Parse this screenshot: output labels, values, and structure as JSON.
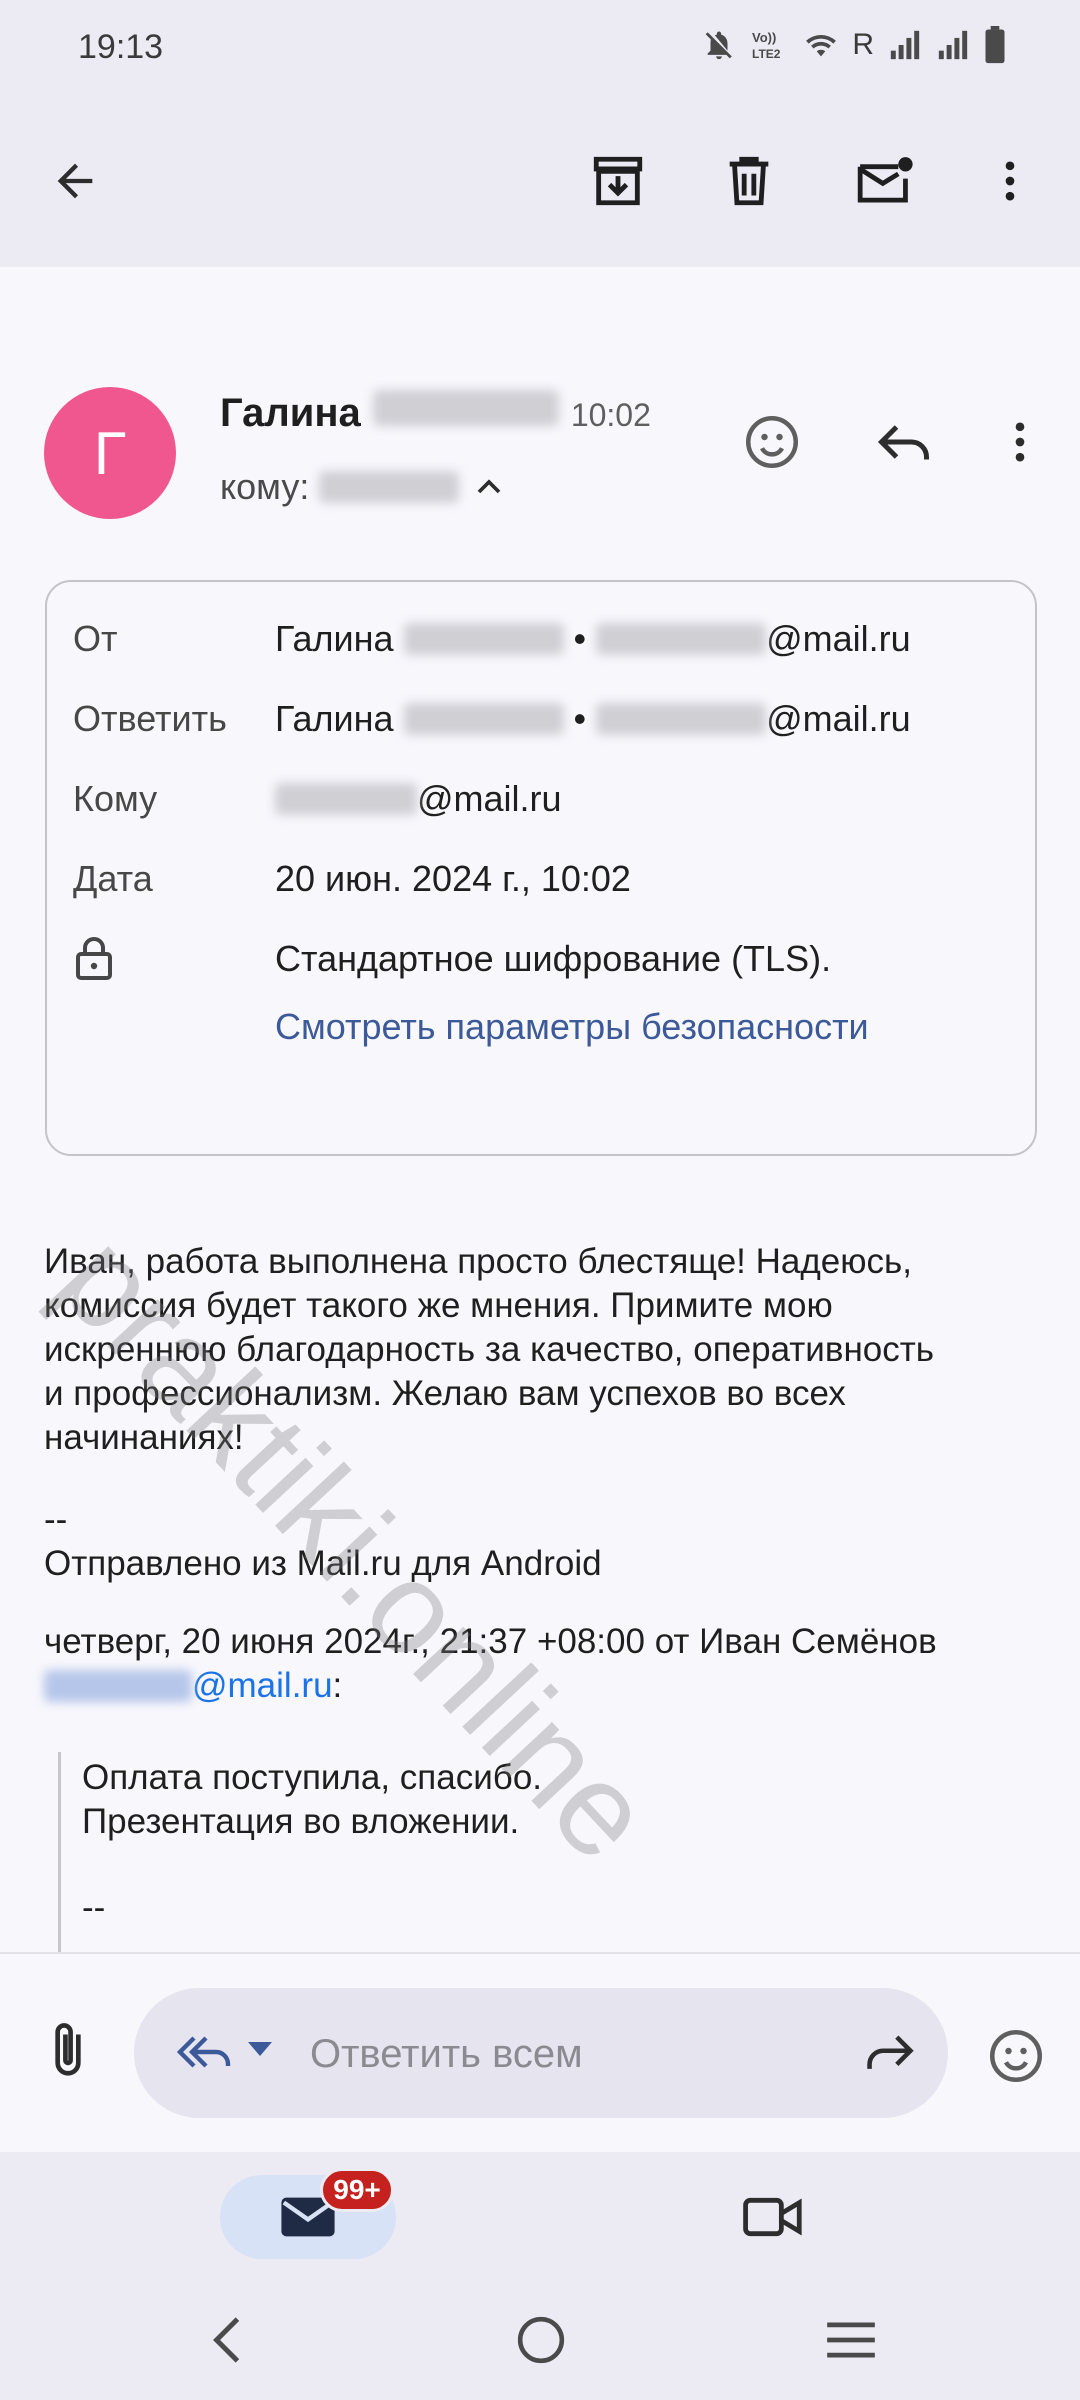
{
  "status_bar": {
    "time": "19:13",
    "roaming_indicator": "R",
    "icons": [
      "bell-off-icon",
      "volte-icon",
      "wifi-icon",
      "signal-icon",
      "signal-icon",
      "battery-icon"
    ]
  },
  "toolbar": {
    "icons": [
      "back-arrow-icon",
      "archive-icon",
      "delete-icon",
      "mark-unread-icon",
      "more-vert-icon"
    ]
  },
  "message_header": {
    "avatar_letter": "Г",
    "avatar_color": "#f0578e",
    "sender_first_name": "Галина",
    "time": "10:02",
    "to_label": "кому:"
  },
  "details": {
    "from_label": "От",
    "from_name": "Галина",
    "from_separator": "•",
    "from_email_domain": "@mail.ru",
    "reply_label": "Ответить",
    "reply_name": "Галина",
    "reply_separator": "•",
    "reply_email_domain": "@mail.ru",
    "to_label": "Кому",
    "to_email_domain": "@mail.ru",
    "date_label": "Дата",
    "date_value": "20 июн. 2024 г., 10:02",
    "encryption_text": "Стандартное шифрование (TLS).",
    "security_link": "Смотреть параметры безопасности"
  },
  "body": {
    "lines": [
      "Иван, работа выполнена просто блестяще! Надеюсь,",
      "комиссия будет такого же мнения. Примите мою",
      "искреннюю благодарность за качество, оперативность",
      "и профессионализм. Желаю вам успехов во всех",
      "начинаниях!"
    ],
    "signature_dash": "--",
    "signature": "Отправлено из Mail.ru для Android",
    "quote_header": "четверг, 20 июня 2024г., 21:37 +08:00 от Иван Семёнов",
    "quote_email_domain": "@mail.ru",
    "quote_colon": ":",
    "quote_lines": [
      "Оплата поступила, спасибо.",
      "Презентация во вложении."
    ],
    "quote_dash": "--"
  },
  "reply_bar": {
    "placeholder": "Ответить всем"
  },
  "bottom_nav": {
    "badge": "99+"
  },
  "watermark": "praktiki.online",
  "colors": {
    "accent_link": "#3c5a99",
    "badge": "#c5221f",
    "background": "#f8f7fc",
    "bars": "#eceaf3"
  }
}
